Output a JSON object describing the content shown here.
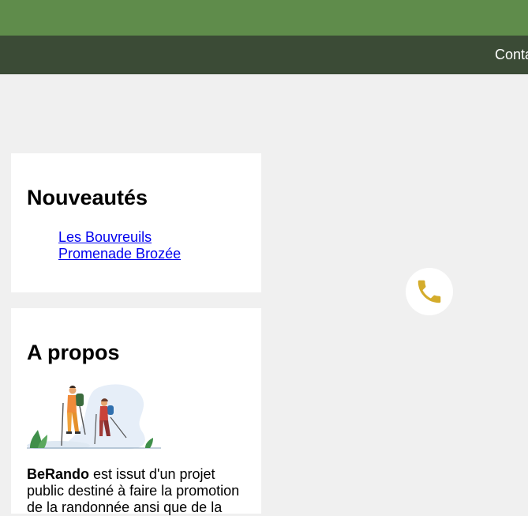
{
  "nav": {
    "contact_label": "Conta"
  },
  "news": {
    "title": "Nouveautés",
    "items": [
      {
        "label": "Les Bouvreuils"
      },
      {
        "label": "Promenade Brozée"
      }
    ]
  },
  "about": {
    "title": "A propos",
    "brand": "BeRando",
    "text_line1": " est issut d'un projet",
    "text_line2": "public destiné à faire la promotion",
    "text_line3": "de la randonnée ansi que de la"
  },
  "colors": {
    "topbar": "#5f8c4b",
    "navbar": "#3b4b36",
    "phone_icon": "#d4ac2b"
  },
  "icons": {
    "phone": "phone-icon",
    "illustration": "hikers-illustration"
  }
}
